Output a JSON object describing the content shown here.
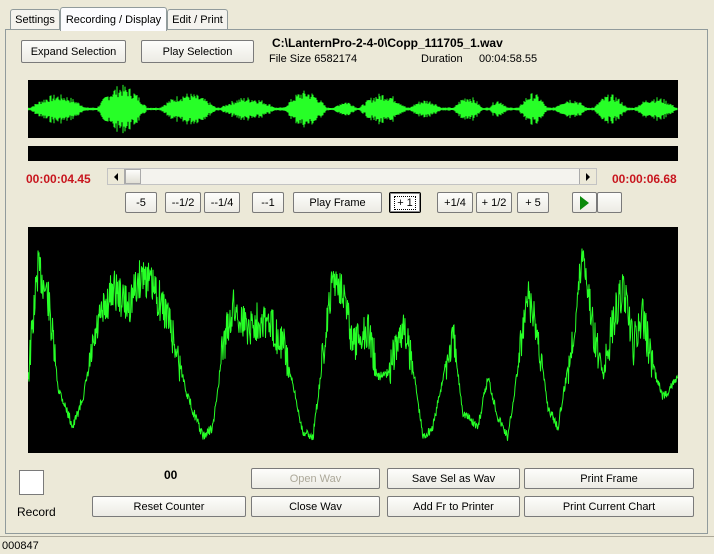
{
  "tabs": [
    {
      "label": "Settings"
    },
    {
      "label": "Recording / Display"
    },
    {
      "label": "Edit / Print"
    }
  ],
  "file": {
    "path": "C:\\LanternPro-2-4-0\\Copp_111705_1.wav",
    "size_label": "File Size 6582174",
    "duration_label": "Duration",
    "duration_value": "00:04:58.55"
  },
  "buttons": {
    "expand_selection": "Expand Selection",
    "play_selection": "Play Selection",
    "minus5": "-5",
    "minus_half": "--1/2",
    "minus_quarter": "--1/4",
    "minus1": "--1",
    "play_frame": "Play Frame",
    "plus1": "+ 1",
    "plus_quarter": "+1/4",
    "plus_half": "+ 1/2",
    "plus5": "+ 5",
    "open_wav": "Open Wav",
    "save_sel": "Save Sel as Wav",
    "print_frame": "Print Frame",
    "reset_counter": "Reset Counter",
    "close_wav": "Close Wav",
    "add_fr": "Add Fr to Printer",
    "print_chart": "Print Current Chart"
  },
  "times": {
    "start": "00:00:04.45",
    "end": "00:00:06.68"
  },
  "counter": "00",
  "record_label": "Record",
  "status": "000847",
  "colors": {
    "waveform": "#27ff27",
    "time_text": "#c8161e",
    "background": "#ece9d8"
  },
  "icons": {
    "scroll_left": "triangle-left",
    "scroll_right": "triangle-right",
    "play": "play-triangle"
  }
}
